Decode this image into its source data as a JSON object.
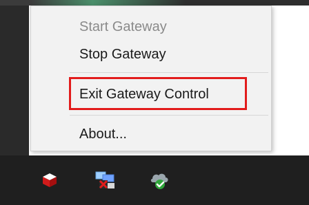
{
  "context_menu": {
    "items": [
      {
        "label": "Start Gateway",
        "enabled": false
      },
      {
        "label": "Stop Gateway",
        "enabled": true
      },
      {
        "label": "Exit Gateway Control",
        "enabled": true,
        "highlighted": true
      },
      {
        "label": "About...",
        "enabled": true
      }
    ]
  },
  "highlight_color": "#e21b1b",
  "taskbar": {
    "tray_icons": [
      "gateway-control-icon",
      "network-connection-icon",
      "cloud-sync-icon"
    ]
  }
}
